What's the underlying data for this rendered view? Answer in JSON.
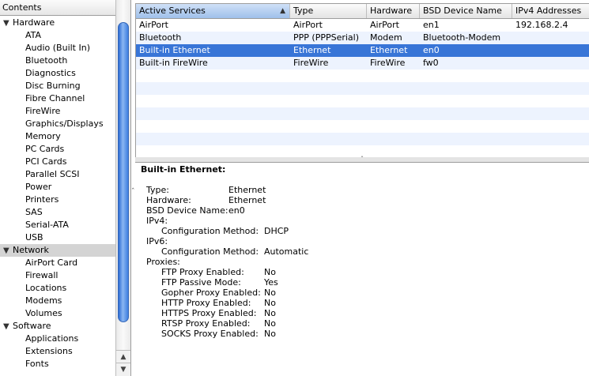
{
  "sidebar": {
    "header": "Contents",
    "tree": [
      {
        "label": "Hardware",
        "type": "cat",
        "expanded": true
      },
      {
        "label": "ATA",
        "type": "child"
      },
      {
        "label": "Audio (Built In)",
        "type": "child"
      },
      {
        "label": "Bluetooth",
        "type": "child"
      },
      {
        "label": "Diagnostics",
        "type": "child"
      },
      {
        "label": "Disc Burning",
        "type": "child"
      },
      {
        "label": "Fibre Channel",
        "type": "child"
      },
      {
        "label": "FireWire",
        "type": "child"
      },
      {
        "label": "Graphics/Displays",
        "type": "child"
      },
      {
        "label": "Memory",
        "type": "child"
      },
      {
        "label": "PC Cards",
        "type": "child"
      },
      {
        "label": "PCI Cards",
        "type": "child"
      },
      {
        "label": "Parallel SCSI",
        "type": "child"
      },
      {
        "label": "Power",
        "type": "child"
      },
      {
        "label": "Printers",
        "type": "child"
      },
      {
        "label": "SAS",
        "type": "child"
      },
      {
        "label": "Serial-ATA",
        "type": "child"
      },
      {
        "label": "USB",
        "type": "child"
      },
      {
        "label": "Network",
        "type": "cat",
        "expanded": true,
        "selected": true
      },
      {
        "label": "AirPort Card",
        "type": "child"
      },
      {
        "label": "Firewall",
        "type": "child"
      },
      {
        "label": "Locations",
        "type": "child"
      },
      {
        "label": "Modems",
        "type": "child"
      },
      {
        "label": "Volumes",
        "type": "child"
      },
      {
        "label": "Software",
        "type": "cat",
        "expanded": true
      },
      {
        "label": "Applications",
        "type": "child"
      },
      {
        "label": "Extensions",
        "type": "child"
      },
      {
        "label": "Fonts",
        "type": "child"
      }
    ]
  },
  "table": {
    "columns": [
      "Active Services",
      "Type",
      "Hardware",
      "BSD Device Name",
      "IPv4 Addresses"
    ],
    "rows": [
      [
        "AirPort",
        "AirPort",
        "AirPort",
        "en1",
        "192.168.2.4"
      ],
      [
        "Bluetooth",
        "PPP (PPPSerial)",
        "Modem",
        "Bluetooth-Modem",
        ""
      ],
      [
        "Built-in Ethernet",
        "Ethernet",
        "Ethernet",
        "en0",
        ""
      ],
      [
        "Built-in FireWire",
        "FireWire",
        "FireWire",
        "fw0",
        ""
      ]
    ],
    "selected_row": 2,
    "sorted_column": 0,
    "sort_arrow": "▲"
  },
  "detail": {
    "title": "Built-in Ethernet:",
    "lines": [
      {
        "k": "Type:",
        "v": "Ethernet",
        "indent": 0
      },
      {
        "k": "Hardware:",
        "v": "Ethernet",
        "indent": 0
      },
      {
        "k": "BSD Device Name:",
        "v": "en0",
        "indent": 0
      },
      {
        "k": "IPv4:",
        "v": "",
        "indent": 0
      },
      {
        "k": "Configuration Method:",
        "v": "DHCP",
        "indent": 1
      },
      {
        "k": "IPv6:",
        "v": "",
        "indent": 0
      },
      {
        "k": "Configuration Method:",
        "v": "Automatic",
        "indent": 1
      },
      {
        "k": "Proxies:",
        "v": "",
        "indent": 0
      },
      {
        "k": "FTP Proxy Enabled:",
        "v": "No",
        "indent": 1
      },
      {
        "k": "FTP Passive Mode:",
        "v": "Yes",
        "indent": 1
      },
      {
        "k": "Gopher Proxy Enabled:",
        "v": "No",
        "indent": 1
      },
      {
        "k": "HTTP Proxy Enabled:",
        "v": "No",
        "indent": 1
      },
      {
        "k": "HTTPS Proxy Enabled:",
        "v": "No",
        "indent": 1
      },
      {
        "k": "RTSP Proxy Enabled:",
        "v": "No",
        "indent": 1
      },
      {
        "k": "SOCKS Proxy Enabled:",
        "v": "No",
        "indent": 1
      }
    ]
  },
  "icons": {
    "expand": "▼",
    "scroll_up": "▲",
    "scroll_down": "▼",
    "split_handle": "ˆ",
    "side_handle": "ˆ"
  },
  "colors": {
    "selection": "#3875d7",
    "alt_row": "#edf3fe",
    "sidebar_selected": "#d4d4d4"
  }
}
